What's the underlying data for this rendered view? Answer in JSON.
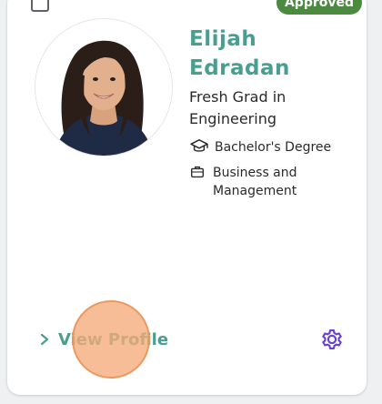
{
  "card": {
    "status_badge": "Approved",
    "name_line1": "Elijah",
    "name_line2": "Edradan",
    "role_line1": "Fresh Grad in",
    "role_line2": "Engineering",
    "degree": "Bachelor's Degree",
    "field_line1": "Business and",
    "field_line2": "Management",
    "view_profile_label": "View Profile"
  },
  "icons": {
    "checkbox": "checkbox-icon",
    "degree": "graduation-cap-icon",
    "field": "briefcase-icon",
    "view_profile": "chevron-right-icon",
    "settings": "gear-icon"
  },
  "colors": {
    "accent_teal": "#4a9e8f",
    "badge_green": "#4c8b3f",
    "settings_purple": "#6a3fd1",
    "tap_indicator": "#f5aa78"
  }
}
